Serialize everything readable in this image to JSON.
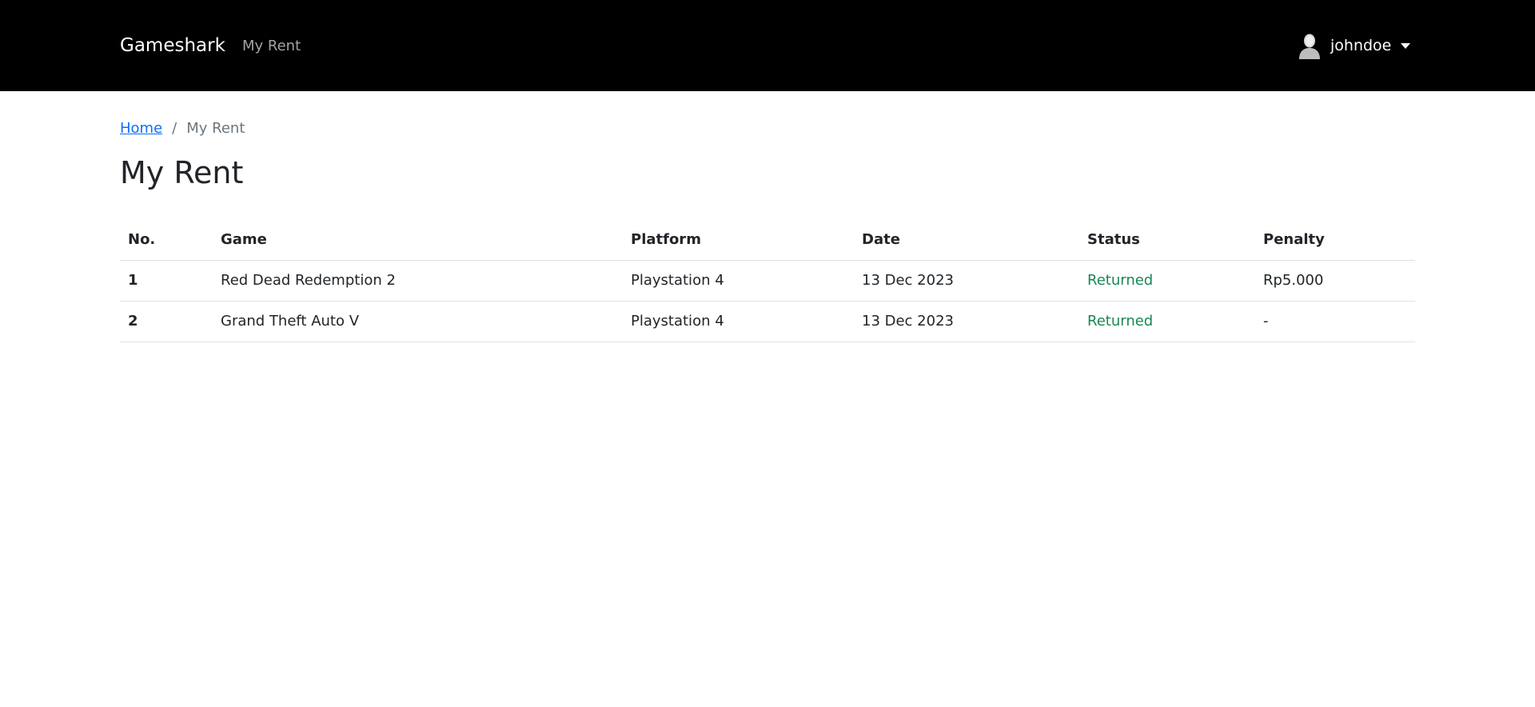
{
  "navbar": {
    "brand": "Gameshark",
    "links": [
      {
        "label": "My Rent"
      }
    ],
    "user": {
      "name": "johndoe"
    }
  },
  "breadcrumb": {
    "home": "Home",
    "separator": "/",
    "current": "My Rent"
  },
  "page": {
    "title": "My Rent"
  },
  "table": {
    "headers": [
      "No.",
      "Game",
      "Platform",
      "Date",
      "Status",
      "Penalty"
    ],
    "rows": [
      {
        "no": "1",
        "game": "Red Dead Redemption 2",
        "platform": "Playstation 4",
        "date": "13 Dec 2023",
        "status": "Returned",
        "penalty": "Rp5.000"
      },
      {
        "no": "2",
        "game": "Grand Theft Auto V",
        "platform": "Playstation 4",
        "date": "13 Dec 2023",
        "status": "Returned",
        "penalty": "-"
      }
    ]
  },
  "colors": {
    "navbar_bg": "#000000",
    "link": "#0d6efd",
    "status_returned": "#198754"
  }
}
